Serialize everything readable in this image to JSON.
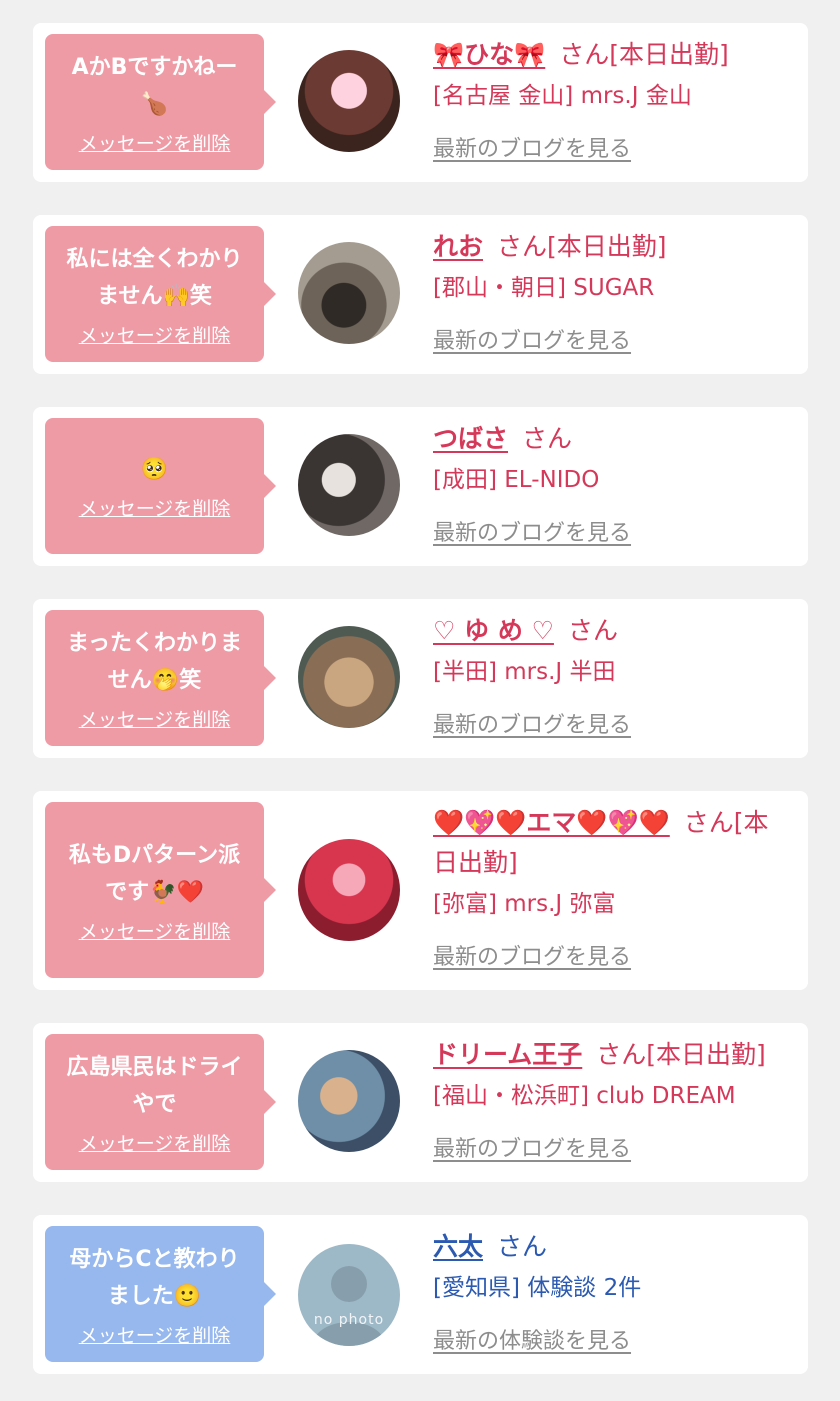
{
  "items": [
    {
      "message": "AかBですかねー\n🍗",
      "delete_label": "メッセージを削除",
      "name": "🎀ひな🎀",
      "name_suffix": "さん[本日出勤]",
      "shop": "[名古屋 金山] mrs.J 金山",
      "link_label": "最新のブログを見る"
    },
    {
      "message": "私には全くわかり\nません🙌笑",
      "delete_label": "メッセージを削除",
      "name": "れお",
      "name_suffix": "さん[本日出勤]",
      "shop": "[郡山・朝日] SUGAR",
      "link_label": "最新のブログを見る"
    },
    {
      "message": "🥺",
      "delete_label": "メッセージを削除",
      "name": "つばさ",
      "name_suffix": "さん",
      "shop": "[成田] EL-NIDO",
      "link_label": "最新のブログを見る"
    },
    {
      "message": "まったくわかりま\nせん🤭笑",
      "delete_label": "メッセージを削除",
      "name": "♡ ゆ め ♡",
      "name_suffix": "さん",
      "shop": "[半田] mrs.J 半田",
      "link_label": "最新のブログを見る"
    },
    {
      "message": "私もDパターン派\nです🐓❤️",
      "delete_label": "メッセージを削除",
      "name": "❤️💖❤️エマ❤️💖❤️",
      "name_suffix": "さん[本日出勤]",
      "shop": "[弥富] mrs.J 弥富",
      "link_label": "最新のブログを見る"
    },
    {
      "message": "広島県民はドライ\nやで",
      "delete_label": "メッセージを削除",
      "name": "ドリーム王子",
      "name_suffix": "さん[本日出勤]",
      "shop": "[福山・松浜町]  club DREAM",
      "link_label": "最新のブログを見る"
    },
    {
      "message": "母からCと教わり\nました🙂",
      "delete_label": "メッセージを削除",
      "name": "六太",
      "name_suffix": "さん",
      "shop": "[愛知県] 体験談 2件",
      "link_label": "最新の体験談を見る",
      "avatar_text": "no photo"
    }
  ],
  "colors": {
    "card_bg": "#ffffff",
    "page_bg": "#f0f0f0",
    "pink_bubble": "#ef9ba6",
    "blue_bubble": "#97b8ee",
    "pink_text": "#d5395a",
    "blue_text": "#2b5ab0",
    "link_gray": "#8d8d8d"
  }
}
